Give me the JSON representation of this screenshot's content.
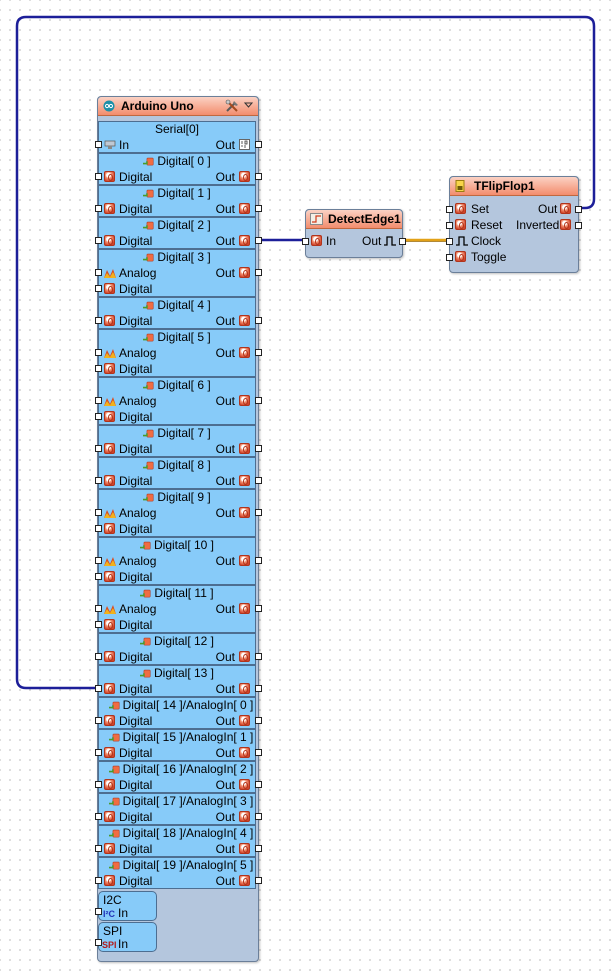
{
  "arduino": {
    "title": "Arduino Uno",
    "serial": {
      "title": "Serial[0]",
      "in_label": "In",
      "out_label": "Out"
    },
    "digital_pins": [
      {
        "title": "Digital[ 0 ]",
        "rows": [
          "Digital"
        ],
        "out": "Out"
      },
      {
        "title": "Digital[ 1 ]",
        "rows": [
          "Digital"
        ],
        "out": "Out"
      },
      {
        "title": "Digital[ 2 ]",
        "rows": [
          "Digital"
        ],
        "out": "Out"
      },
      {
        "title": "Digital[ 3 ]",
        "rows": [
          "Analog",
          "Digital"
        ],
        "out": "Out"
      },
      {
        "title": "Digital[ 4 ]",
        "rows": [
          "Digital"
        ],
        "out": "Out"
      },
      {
        "title": "Digital[ 5 ]",
        "rows": [
          "Analog",
          "Digital"
        ],
        "out": "Out"
      },
      {
        "title": "Digital[ 6 ]",
        "rows": [
          "Analog",
          "Digital"
        ],
        "out": "Out"
      },
      {
        "title": "Digital[ 7 ]",
        "rows": [
          "Digital"
        ],
        "out": "Out"
      },
      {
        "title": "Digital[ 8 ]",
        "rows": [
          "Digital"
        ],
        "out": "Out"
      },
      {
        "title": "Digital[ 9 ]",
        "rows": [
          "Analog",
          "Digital"
        ],
        "out": "Out"
      },
      {
        "title": "Digital[ 10 ]",
        "rows": [
          "Analog",
          "Digital"
        ],
        "out": "Out"
      },
      {
        "title": "Digital[ 11 ]",
        "rows": [
          "Analog",
          "Digital"
        ],
        "out": "Out"
      },
      {
        "title": "Digital[ 12 ]",
        "rows": [
          "Digital"
        ],
        "out": "Out"
      },
      {
        "title": "Digital[ 13 ]",
        "rows": [
          "Digital"
        ],
        "out": "Out"
      },
      {
        "title": "Digital[ 14 ]/AnalogIn[ 0 ]",
        "rows": [
          "Digital"
        ],
        "out": "Out"
      },
      {
        "title": "Digital[ 15 ]/AnalogIn[ 1 ]",
        "rows": [
          "Digital"
        ],
        "out": "Out"
      },
      {
        "title": "Digital[ 16 ]/AnalogIn[ 2 ]",
        "rows": [
          "Digital"
        ],
        "out": "Out"
      },
      {
        "title": "Digital[ 17 ]/AnalogIn[ 3 ]",
        "rows": [
          "Digital"
        ],
        "out": "Out"
      },
      {
        "title": "Digital[ 18 ]/AnalogIn[ 4 ]",
        "rows": [
          "Digital"
        ],
        "out": "Out"
      },
      {
        "title": "Digital[ 19 ]/AnalogIn[ 5 ]",
        "rows": [
          "Digital"
        ],
        "out": "Out"
      }
    ],
    "i2c": {
      "title": "I2C",
      "in_label": "In"
    },
    "spi": {
      "title": "SPI",
      "in_label": "In"
    }
  },
  "detect_edge": {
    "title": "DetectEdge1",
    "in_label": "In",
    "out_label": "Out"
  },
  "flipflop": {
    "title": "TFlipFlop1",
    "inputs": [
      "Set",
      "Reset",
      "Clock",
      "Toggle"
    ],
    "outputs": [
      "Out",
      "Inverted"
    ]
  },
  "colors": {
    "wire_digital": "#1d1f99",
    "wire_clock": "#e2a118",
    "component_body": "#b4c6dd",
    "pin_block": "#87cbf9",
    "title_bar": "#f38c6d"
  }
}
